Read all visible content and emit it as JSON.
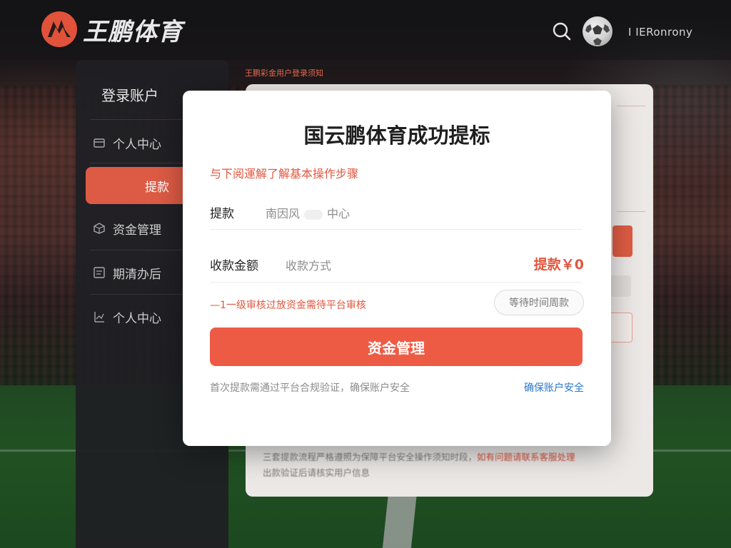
{
  "header": {
    "logo_text": "王鹏体育",
    "username": "I IERonrony"
  },
  "sidebar": {
    "title": "登录账户",
    "items": [
      {
        "label": "个人中心",
        "icon": "card-icon",
        "active": false
      },
      {
        "label": "提款",
        "icon": "",
        "active": true
      },
      {
        "label": "资金管理",
        "icon": "box-icon",
        "active": false
      },
      {
        "label": "期清办后",
        "icon": "list-icon",
        "active": false
      },
      {
        "label": "个人中心",
        "icon": "chart-icon",
        "active": false
      }
    ]
  },
  "background_panel": {
    "caption": "王鹏彩金用户登录须知",
    "note_line1_a": "三套提款流程严格遵照为保障平台安全操作须知时段，",
    "note_line1_b": "如有问题请联系客服处理",
    "note_line2": "出款验证后请核实用户信息"
  },
  "modal": {
    "title": "国云鹏体育成功提标",
    "subtitle": "与下阅運解了解基本操作步骤",
    "withdraw_label": "提款",
    "withdraw_value": "南因风",
    "withdraw_value2": "中心",
    "receive_label": "收款金额",
    "receive_method": "收款方式",
    "amount": "提款￥0",
    "notice": "—1一级审核过放资金需待平台审核",
    "wait_button": "等待时间周款",
    "primary_button": "资金管理",
    "footer_note": "首次提款需通过平台合规验证，确保账户安全",
    "footer_link": "确保账户安全"
  },
  "colors": {
    "accent": "#ee5b45",
    "sidebar_bg": "#202024",
    "link": "#2a78c9"
  }
}
